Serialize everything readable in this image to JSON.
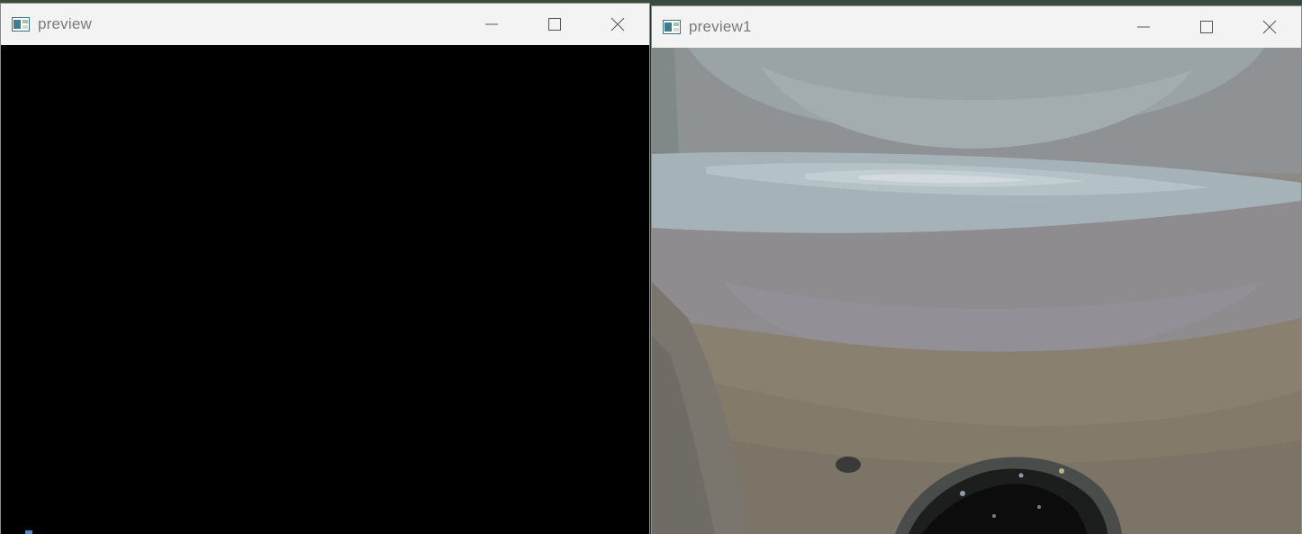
{
  "windows": [
    {
      "title": "preview",
      "icon": "app-window-icon",
      "controls": [
        "minimize-icon",
        "maximize-icon",
        "close-icon"
      ],
      "content": "black frame"
    },
    {
      "title": "preview1",
      "icon": "app-window-icon",
      "controls": [
        "minimize-icon",
        "maximize-icon",
        "close-icon"
      ],
      "content": "posterized camera frame"
    }
  ],
  "colors": {
    "titlebar_bg": "#f3f3f3",
    "title_text": "#7a7a7a",
    "left_client": "#000000",
    "desktop": "#23332a"
  }
}
